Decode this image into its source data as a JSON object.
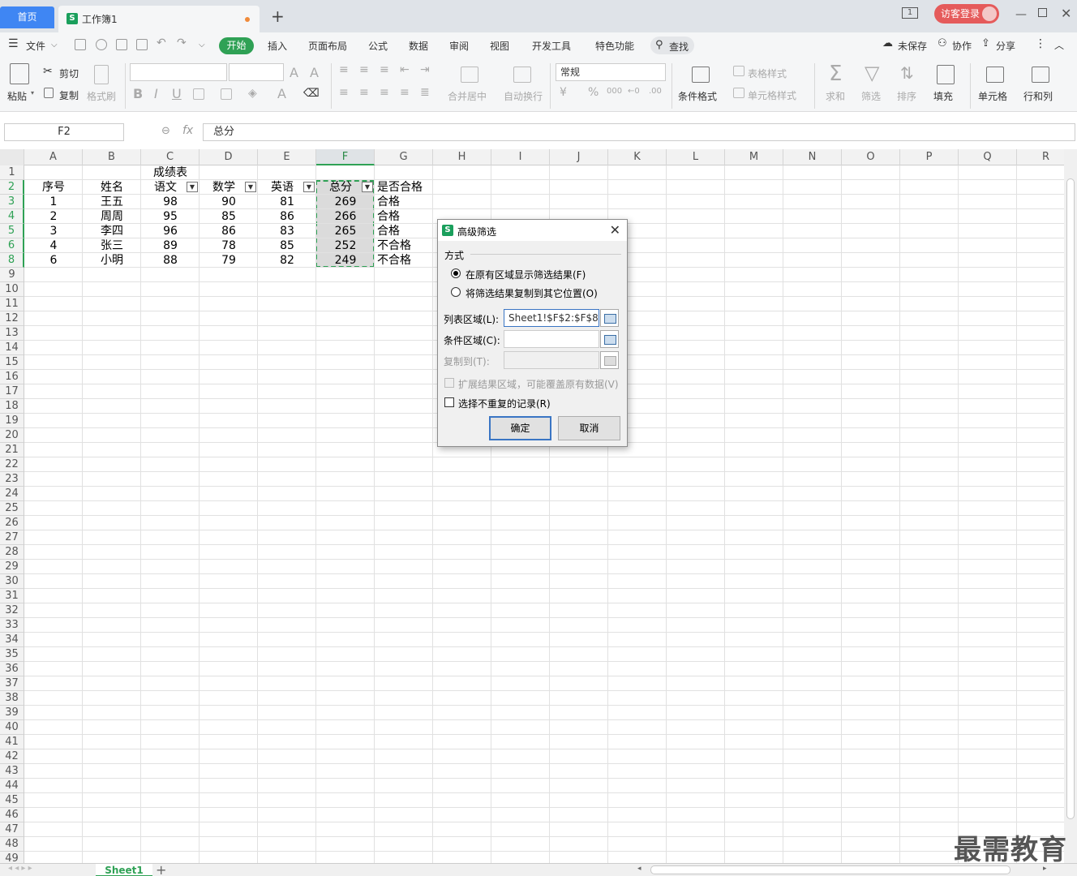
{
  "titlebar": {
    "home_tab": "首页",
    "doc_tab": "工作簿1",
    "new_tab": "+",
    "login": "访客登录",
    "page_count": "1"
  },
  "menubar": {
    "file": "文件",
    "items": [
      "开始",
      "插入",
      "页面布局",
      "公式",
      "数据",
      "审阅",
      "视图",
      "开发工具",
      "特色功能"
    ],
    "search": "查找",
    "unsaved": "未保存",
    "collab": "协作",
    "share": "分享"
  },
  "ribbon": {
    "paste": "粘贴",
    "cut": "剪切",
    "copy": "复制",
    "format_painter": "格式刷",
    "merge_center": "合并居中",
    "wrap": "自动换行",
    "number_format": "常规",
    "cond_format": "条件格式",
    "table_style": "表格样式",
    "cell_style": "单元格样式",
    "sum": "求和",
    "filter": "筛选",
    "sort": "排序",
    "fill": "填充",
    "cells": "单元格",
    "rows_cols": "行和列"
  },
  "formula_bar": {
    "name_box": "F2",
    "fx": "fx",
    "content": "总分"
  },
  "sheet": {
    "columns": [
      "A",
      "B",
      "C",
      "D",
      "E",
      "F",
      "G",
      "H",
      "I",
      "J",
      "K",
      "L",
      "M",
      "N",
      "O",
      "P",
      "Q",
      "R"
    ],
    "selected_column": "F",
    "rows": [
      "1",
      "2",
      "3",
      "4",
      "5",
      "6",
      "8",
      "9",
      "10",
      "11",
      "12",
      "13",
      "14",
      "15",
      "16",
      "17",
      "18",
      "19",
      "20",
      "21",
      "22",
      "23",
      "24",
      "25",
      "26",
      "27",
      "28",
      "29",
      "30",
      "31",
      "32",
      "33",
      "34",
      "35",
      "36",
      "37",
      "38",
      "39",
      "40",
      "41",
      "42",
      "43",
      "44",
      "45",
      "46",
      "47",
      "48",
      "49"
    ],
    "title": "成绩表",
    "headers": [
      "序号",
      "姓名",
      "语文",
      "数学",
      "英语",
      "总分",
      "是否合格"
    ],
    "data": [
      [
        "1",
        "王五",
        "98",
        "90",
        "81",
        "269",
        "合格"
      ],
      [
        "2",
        "周周",
        "95",
        "85",
        "86",
        "266",
        "合格"
      ],
      [
        "3",
        "李四",
        "96",
        "86",
        "83",
        "265",
        "合格"
      ],
      [
        "4",
        "张三",
        "89",
        "78",
        "85",
        "252",
        "不合格"
      ],
      [
        "6",
        "小明",
        "88",
        "79",
        "82",
        "249",
        "不合格"
      ]
    ]
  },
  "sheet_tabs": {
    "active": "Sheet1",
    "add": "+"
  },
  "watermark": "最需教育",
  "dialog": {
    "title": "高级筛选",
    "group_label": "方式",
    "option1": "在原有区域显示筛选结果(F)",
    "option2": "将筛选结果复制到其它位置(O)",
    "list_range_label": "列表区域(L):",
    "list_range_value": "Sheet1!$F$2:$F$8",
    "criteria_label": "条件区域(C):",
    "criteria_value": "",
    "copy_to_label": "复制到(T):",
    "copy_to_value": "",
    "expand_label": "扩展结果区域，可能覆盖原有数据(V)",
    "unique_label": "选择不重复的记录(R)",
    "ok": "确定",
    "cancel": "取消"
  }
}
